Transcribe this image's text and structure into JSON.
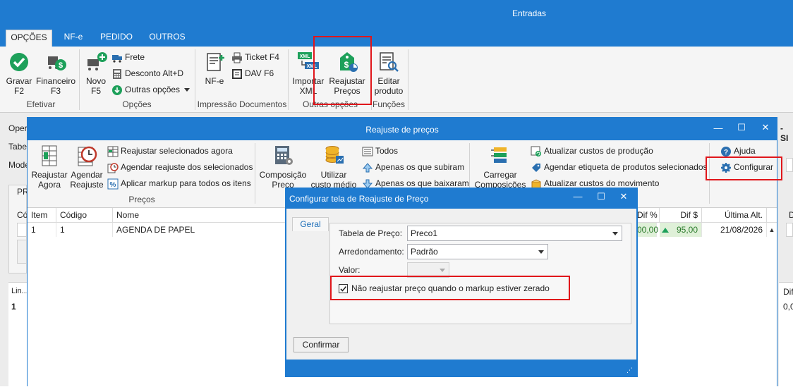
{
  "main_window": {
    "title": "Entradas",
    "tabs": [
      "OPÇÕES",
      "NF-e",
      "PEDIDO",
      "OUTROS"
    ],
    "groups": {
      "efetivar": {
        "label": "Efetivar",
        "gravar": "Gravar\nF2",
        "financeiro": "Financeiro\nF3"
      },
      "opcoes": {
        "label": "Opções",
        "novo": "Novo\nF5",
        "frete": "Frete",
        "desconto": "Desconto Alt+D",
        "outras_opcoes": "Outras opções"
      },
      "impressao": {
        "label": "Impressão Documentos",
        "nfe": "NF-e",
        "ticket": "Ticket F4",
        "dav": "DAV F6"
      },
      "outras": {
        "label": "Outras opções",
        "importar_xml": "Importar\nXML",
        "reajustar_precos": "Reajustar\nPreços"
      },
      "funcoes": {
        "label": "Funções",
        "editar_produto": "Editar\nproduto"
      }
    },
    "background_labels": {
      "oper": "Oper",
      "tabel": "Tabel",
      "mode": "Mode",
      "pr_tab": "PR",
      "co": "Có",
      "lin": "Lin...",
      "row_one": "1",
      "right_s": "- SI",
      "right_dif": "Dif",
      "right_zero": "0,0",
      "right_d": "D"
    }
  },
  "reajuste_window": {
    "title": "Reajuste de preços",
    "ribbon": {
      "reajustar_agora": "Reajustar\nAgora",
      "agendar_reajuste": "Agendar\nReajuste",
      "reajustar_selecionados": "Reajustar selecionados agora",
      "agendar_selecionados": "Agendar reajuste dos selecionados",
      "aplicar_markup": "Aplicar markup para todos os itens",
      "precos_label": "Preços",
      "composicao_preco": "Composição\nPreço",
      "utilizar_custo": "Utilizar\ncusto médio",
      "todos": "Todos",
      "apenas_subiram": "Apenas os que subiram",
      "apenas_baixaram": "Apenas os que baixaram",
      "carregar_composicoes": "Carregar\nComposições",
      "atualizar_custos_producao": "Atualizar custos de produção",
      "agendar_etiqueta": "Agendar etiqueta de produtos selecionados",
      "atualizar_custos_movimento": "Atualizar custos do movimento",
      "ajuda": "Ajuda",
      "configurar": "Configurar"
    },
    "grid": {
      "columns": [
        "Item",
        "Código",
        "Nome",
        "Dif %",
        "Dif $",
        "Última Alt."
      ],
      "rows": [
        {
          "item": "1",
          "codigo": "1",
          "nome": "AGENDA DE PAPEL",
          "dif_pct": "00,00",
          "dif_val": "95,00",
          "ultima_alt": "21/08/2026"
        }
      ]
    }
  },
  "config_dialog": {
    "title": "Configurar tela de Reajuste de Preço",
    "tab": "Geral",
    "tabela_label": "Tabela de Preço:",
    "tabela_value": "Preco1",
    "arredondamento_label": "Arredondamento:",
    "arredondamento_value": "Padrão",
    "valor_label": "Valor:",
    "checkbox_label": "Não reajustar preço quando o markup estiver zerado",
    "checkbox_checked": true,
    "confirm_button": "Confirmar"
  },
  "colors": {
    "accent": "#1f7bd0",
    "highlight_red": "#e0161b",
    "green_icon": "#1da05a"
  }
}
